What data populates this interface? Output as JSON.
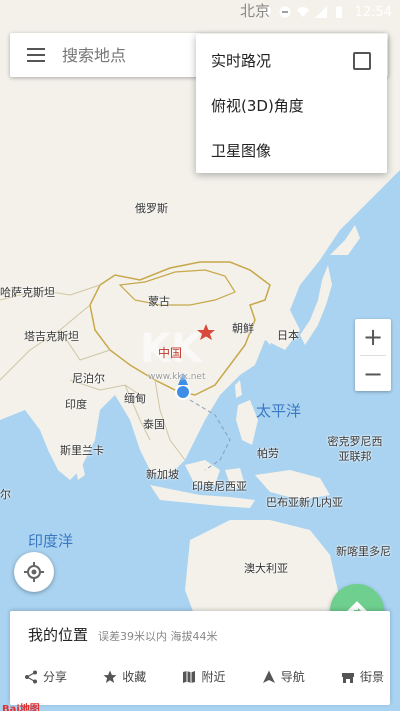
{
  "status_bar": {
    "time": "12:54",
    "bg_city": "北京"
  },
  "search": {
    "placeholder": "搜索地点"
  },
  "menu": {
    "items": [
      {
        "label": "实时路况",
        "has_checkbox": true,
        "checked": false
      },
      {
        "label": "俯视(3D)角度"
      },
      {
        "label": "卫星图像"
      }
    ]
  },
  "map": {
    "labels": {
      "russia": "俄罗斯",
      "kazakhstan": "哈萨克斯坦",
      "mongolia": "蒙古",
      "tajikistan": "塔吉克斯坦",
      "china": "中国",
      "north_korea": "朝鲜",
      "japan": "日本",
      "nepal": "尼泊尔",
      "india": "印度",
      "myanmar": "缅甸",
      "thailand": "泰国",
      "pacific": "太平洋",
      "palau": "帕劳",
      "micronesia": "密克罗尼西亚联邦",
      "sri_lanka": "斯里兰卡",
      "singapore": "新加坡",
      "indonesia": "印度尼西亚",
      "png": "巴布亚新几内亚",
      "indian_ocean": "印度洋",
      "new_caledonia": "新喀里多尼",
      "australia": "澳大利亚",
      "ir_partial": "尔",
      "watermark": "www.kkx.net"
    }
  },
  "zoom": {
    "in": "+",
    "out": "−"
  },
  "card": {
    "title": "我的位置",
    "detail": "误差39米以内  海拔44米",
    "actions": [
      {
        "label": "分享",
        "icon": "share-icon"
      },
      {
        "label": "收藏",
        "icon": "star-icon"
      },
      {
        "label": "附近",
        "icon": "map-icon"
      },
      {
        "label": "导航",
        "icon": "navigation-icon"
      },
      {
        "label": "街景",
        "icon": "street-view-icon"
      }
    ]
  },
  "logo": "Bai地图",
  "colors": {
    "sea": "#a9d3f1",
    "land": "#f3f1ea",
    "fab": "#6fcf8f",
    "border": "#c8a84a"
  }
}
